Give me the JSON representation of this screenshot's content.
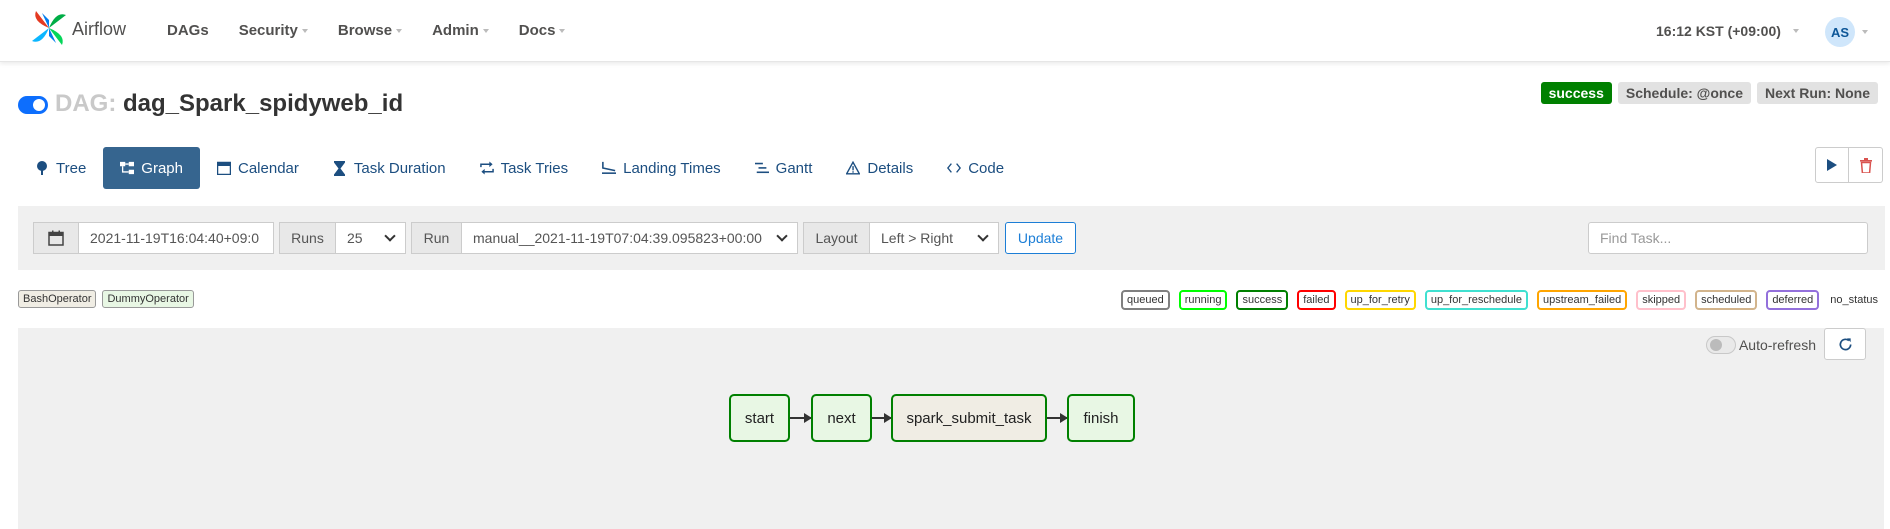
{
  "navbar": {
    "brand": "Airflow",
    "links": [
      {
        "label": "DAGs",
        "dropdown": false
      },
      {
        "label": "Security",
        "dropdown": true
      },
      {
        "label": "Browse",
        "dropdown": true
      },
      {
        "label": "Admin",
        "dropdown": true
      },
      {
        "label": "Docs",
        "dropdown": true
      }
    ],
    "clock": "16:12 KST (+09:00)",
    "user_initials": "AS"
  },
  "dag": {
    "prefix": "DAG:",
    "dag_id": "dag_Spark_spidyweb_id",
    "paused": false,
    "state_badge": "success",
    "schedule_badge": "Schedule: @once",
    "next_run_badge": "Next Run: None"
  },
  "tabs": [
    {
      "label": "Tree",
      "icon": "tree-icon",
      "active": false
    },
    {
      "label": "Graph",
      "icon": "graph-icon",
      "active": true
    },
    {
      "label": "Calendar",
      "icon": "calendar-icon",
      "active": false
    },
    {
      "label": "Task Duration",
      "icon": "hourglass-icon",
      "active": false
    },
    {
      "label": "Task Tries",
      "icon": "repeat-icon",
      "active": false
    },
    {
      "label": "Landing Times",
      "icon": "plane-landing-icon",
      "active": false
    },
    {
      "label": "Gantt",
      "icon": "gantt-icon",
      "active": false
    },
    {
      "label": "Details",
      "icon": "details-icon",
      "active": false
    },
    {
      "label": "Code",
      "icon": "code-icon",
      "active": false
    }
  ],
  "filter": {
    "base_date": "2021-11-19T16:04:40+09:0",
    "runs_label": "Runs",
    "runs_value": "25",
    "run_label": "Run",
    "run_value": "manual__2021-11-19T07:04:39.095823+00:00",
    "layout_label": "Layout",
    "layout_value": "Left > Right",
    "update_label": "Update",
    "find_placeholder": "Find Task..."
  },
  "operators": [
    {
      "label": "BashOperator",
      "color": "#f0ede4"
    },
    {
      "label": "DummyOperator",
      "color": "#e8f7e4"
    }
  ],
  "states": [
    {
      "label": "queued",
      "color": "#808080"
    },
    {
      "label": "running",
      "color": "#00ff00"
    },
    {
      "label": "success",
      "color": "#008000"
    },
    {
      "label": "failed",
      "color": "#ff0000"
    },
    {
      "label": "up_for_retry",
      "color": "#ffd700"
    },
    {
      "label": "up_for_reschedule",
      "color": "#40e0d0"
    },
    {
      "label": "upstream_failed",
      "color": "#ffa500"
    },
    {
      "label": "skipped",
      "color": "#ffc0cb"
    },
    {
      "label": "scheduled",
      "color": "#d2b48c"
    },
    {
      "label": "deferred",
      "color": "#9370db"
    },
    {
      "label": "no_status",
      "color": null
    }
  ],
  "graph": {
    "auto_refresh_label": "Auto-refresh",
    "auto_refresh_on": false,
    "tasks": [
      {
        "task_id": "start",
        "state": "success",
        "operator": "DummyOperator"
      },
      {
        "task_id": "next",
        "state": "success",
        "operator": "DummyOperator"
      },
      {
        "task_id": "spark_submit_task",
        "state": "success",
        "operator": "BashOperator"
      },
      {
        "task_id": "finish",
        "state": "success",
        "operator": "DummyOperator"
      }
    ]
  }
}
